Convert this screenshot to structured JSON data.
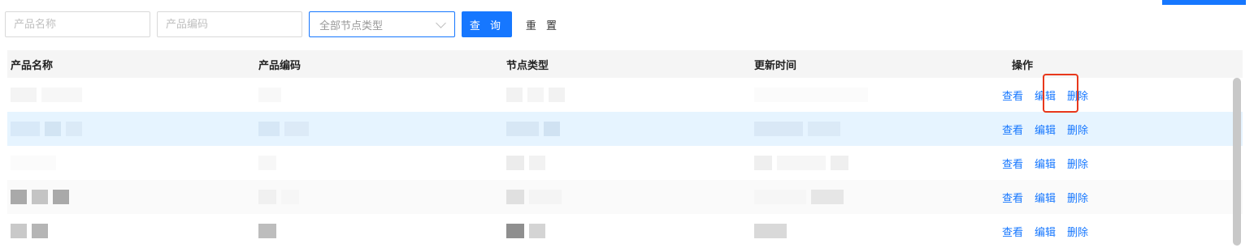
{
  "filters": {
    "product_name_placeholder": "产品名称",
    "product_code_placeholder": "产品编码",
    "node_type_selected": "全部节点类型",
    "search_label": "查 询",
    "reset_label": "重 置"
  },
  "table": {
    "headers": {
      "product_name": "产品名称",
      "product_code": "产品编码",
      "node_type": "节点类型",
      "updated_at": "更新时间",
      "actions": "操作"
    },
    "actions": {
      "view": "查看",
      "edit": "编辑",
      "delete": "删除"
    }
  },
  "colors": {
    "primary": "#1677ff",
    "highlight_row": "#e6f4ff",
    "annotation_box": "#e8381c"
  }
}
